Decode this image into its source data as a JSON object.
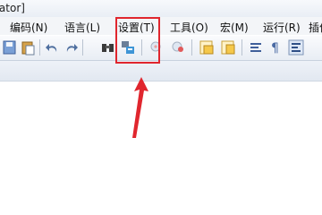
{
  "window": {
    "title_fragment": "rator]"
  },
  "menubar": {
    "items": [
      {
        "label": ")"
      },
      {
        "label": "编码(N)"
      },
      {
        "label": "语言(L)"
      },
      {
        "label": "设置(T)"
      },
      {
        "label": "工具(O)"
      },
      {
        "label": "宏(M)"
      },
      {
        "label": "运行(R)"
      },
      {
        "label": "插件"
      }
    ],
    "highlighted": "设置(T)"
  },
  "toolbar": {
    "icons": [
      "save-icon",
      "paste-icon",
      "undo-icon",
      "redo-icon",
      "find-icon",
      "replace-icon",
      "zoom-in-icon",
      "zoom-out-icon",
      "sync-vertical-icon",
      "sync-horizontal-icon",
      "word-wrap-icon",
      "show-all-chars-icon",
      "indent-guide-icon"
    ]
  },
  "annotation": {
    "highlight_color": "#e0262e",
    "arrow_color": "#e0262e"
  }
}
